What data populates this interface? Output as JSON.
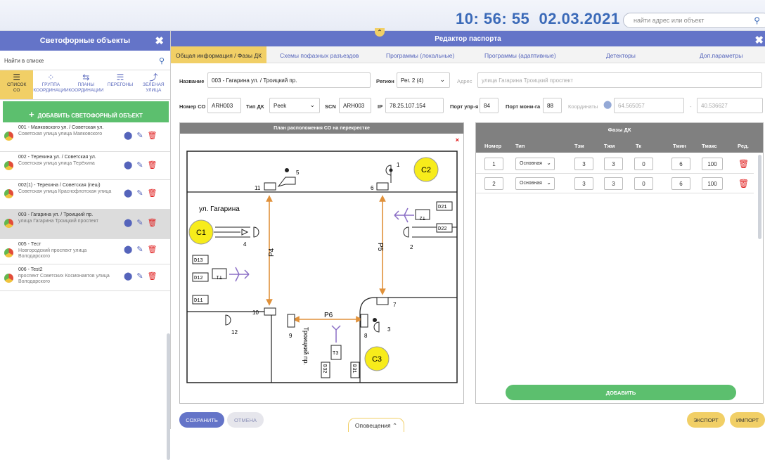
{
  "top": {
    "time": "10: 56: 55",
    "date": "02.03.2021",
    "search_placeholder": "найти адрес или объект"
  },
  "sidebar": {
    "title": "Светофорные объекты",
    "search_placeholder": "Найти в списке",
    "tabs": [
      {
        "l1": "СПИСОК",
        "l2": "СО"
      },
      {
        "l1": "ГРУППА",
        "l2": "КООРДИНАЦИИ"
      },
      {
        "l1": "ПЛАНЫ",
        "l2": "КООРДИНАЦИИ"
      },
      {
        "l1": "ПЕРЕГОНЫ",
        "l2": ""
      },
      {
        "l1": "ЗЕЛЕНАЯ",
        "l2": "УЛИЦА"
      }
    ],
    "add_label": "ДОБАВИТЬ СВЕТОФОРНЫЙ ОБЪЕКТ",
    "items": [
      {
        "title": "001 - Маяковского ул. / Советская ул.",
        "subtitle": "Советская улица улица Маяковского"
      },
      {
        "title": "002 - Терехина ул. / Советская ул.",
        "subtitle": "Советская улица улица Терёхина"
      },
      {
        "title": "002(1) - Терехина / Советская (пеш)",
        "subtitle": "Советская улица Краснофлотская улица"
      },
      {
        "title": "003 - Гагарина ул. / Троицкий пр.",
        "subtitle": "улица Гагарина Троицкий проспект"
      },
      {
        "title": "005 - Тест",
        "subtitle": "Новгородский проспект улица Володарского"
      },
      {
        "title": "006 - Test2",
        "subtitle": "проспект Советских Космонавтов улица Володарского"
      }
    ]
  },
  "editor": {
    "title": "Редактор паспорта",
    "tabs": [
      "Общая информация / Фазы ДК",
      "Схемы пофазных разъездов",
      "Программы (локальные)",
      "Программы (адаптивные)",
      "Детекторы",
      "Доп.параметры"
    ],
    "form": {
      "name_label": "Название",
      "name_value": "003 - Гагарина ул. / Троицкий пр.",
      "region_label": "Регион",
      "region_value": "Рег. 2 (4)",
      "address_label": "Адрес",
      "address_placeholder": "улица Гагарина Троицкий проспект",
      "number_label": "Номер СО",
      "number_value": "ARH003",
      "type_label": "Тип ДК",
      "type_value": "Peek",
      "scn_label": "SCN",
      "scn_value": "ARH003",
      "ip_label": "IP",
      "ip_value": "78.25.107.154",
      "port_ctrl_label": "Порт упр-я",
      "port_ctrl_value": "84",
      "port_mon_label": "Порт мони-га",
      "port_mon_value": "88",
      "coords_label": "Координаты",
      "lat": "64.565057",
      "coord_sep": "-",
      "lon": "40.536627"
    },
    "plan": {
      "title": "План расположения СО на перекрестке",
      "close": "×",
      "street_top": "ул. Гагарина",
      "street_vert": "Троицкий пр.",
      "circles": [
        "C1",
        "C2",
        "C3"
      ],
      "signals": [
        "1",
        "2",
        "3",
        "4",
        "5",
        "6",
        "7",
        "8",
        "9",
        "10",
        "11",
        "12"
      ],
      "detectors": [
        "D21",
        "D22",
        "D13",
        "D12",
        "D11",
        "D32",
        "D31"
      ],
      "boxes": [
        "T1",
        "T2",
        "T3"
      ],
      "paths": [
        "P4",
        "P5",
        "P6"
      ]
    },
    "phases": {
      "title": "Фазы ДК",
      "columns": [
        "Номер",
        "Тип",
        "Тзм",
        "Тжм",
        "Тк",
        "Тмин",
        "Тмакс",
        "Ред."
      ],
      "rows": [
        {
          "num": "1",
          "type": "Основная",
          "tzm": "3",
          "tzhm": "3",
          "tk": "0",
          "tmin": "6",
          "tmax": "100"
        },
        {
          "num": "2",
          "type": "Основная",
          "tzm": "3",
          "tzhm": "3",
          "tk": "0",
          "tmin": "6",
          "tmax": "100"
        }
      ],
      "add_label": "ДОБАВИТЬ"
    },
    "footer": {
      "save": "СОХРАНИТЬ",
      "cancel": "ОТМЕНА",
      "notifications": "Оповещения ⌃",
      "export": "ЭКСПОРТ",
      "import": "ИМПОРТ"
    }
  },
  "colors": {
    "accent": "#6474c8",
    "yellow": "#f1cf66",
    "green": "#5cbf6e",
    "red": "#e02020",
    "orange_path": "#e0913a",
    "purple": "#8b6fc6"
  }
}
